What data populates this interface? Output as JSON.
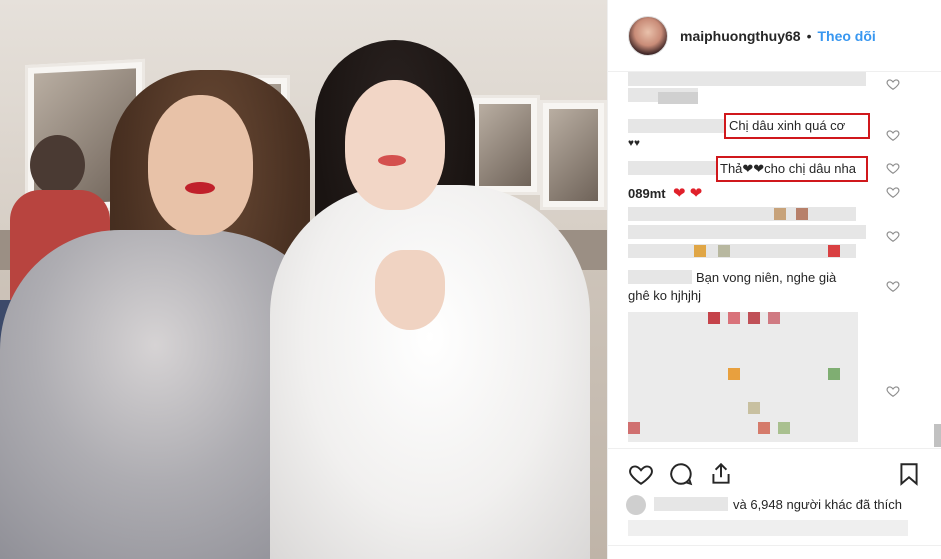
{
  "post": {
    "username": "maiphuongthuy68",
    "separator": "•",
    "follow_label": "Theo dõi"
  },
  "comments": {
    "c1_hearts": "♥♥",
    "c2_text": "Chị dâu xinh quá cơ",
    "c3_text": "Thả❤❤cho chị dâu nha",
    "c4_user": "089mt",
    "c4_hearts": "❤ ❤",
    "c5_text_line1": "Bạn vong niên, nghe già",
    "c5_text_line2": "ghê ko hjhjhj"
  },
  "likes": {
    "text": "và 6,948 người khác đã thích"
  },
  "icons": [
    "heart-icon",
    "comment-icon",
    "share-icon",
    "bookmark-icon"
  ],
  "colors": {
    "follow": "#3897f0",
    "highlight_box": "#d0181c",
    "emoji_heart": "#e0202a"
  }
}
